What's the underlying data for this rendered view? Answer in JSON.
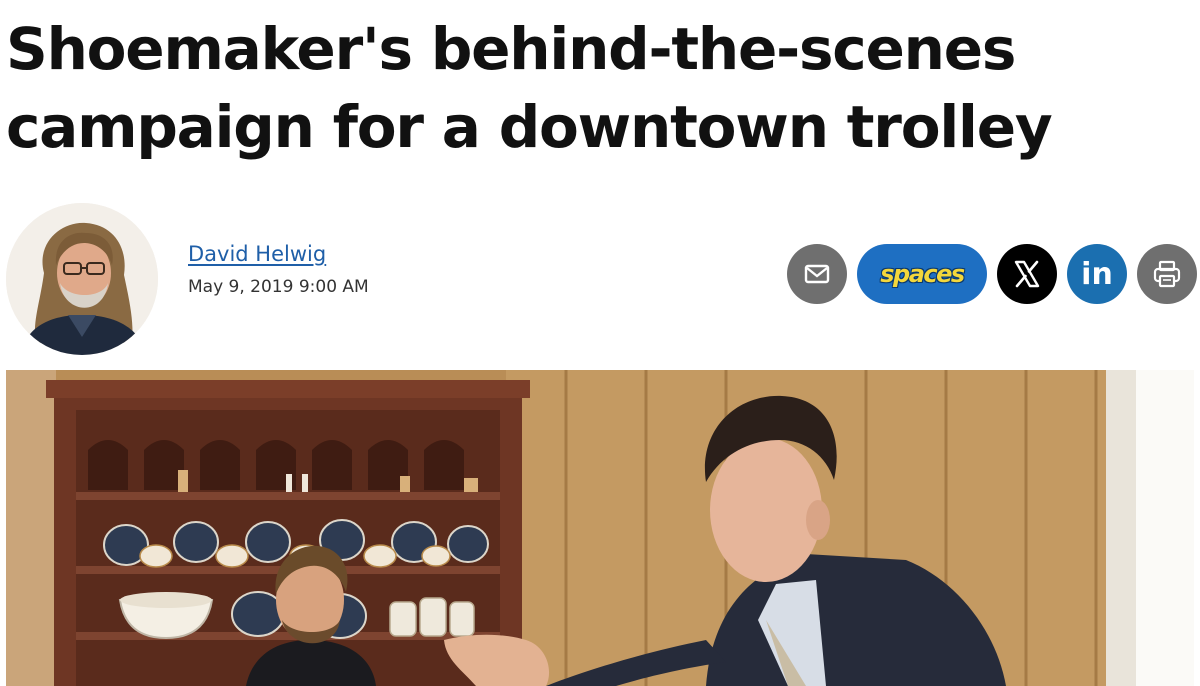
{
  "article": {
    "headline_line1": "Shoemaker's behind-the-scenes",
    "headline_line2": "campaign for a downtown trolley",
    "author_name": "David Helwig",
    "published": "May 9, 2019 9:00 AM"
  },
  "share": {
    "email_icon": "envelope-icon",
    "spaces_label": "spaces",
    "x_icon": "x-logo-icon",
    "linkedin_label": "in",
    "print_icon": "printer-icon"
  },
  "colors": {
    "author_link": "#1f5fa8",
    "spaces_bg": "#1e6fc2",
    "spaces_text": "#f4d73b",
    "linkedin_bg": "#1b6fb0",
    "icon_gray": "#6f6f6f"
  }
}
